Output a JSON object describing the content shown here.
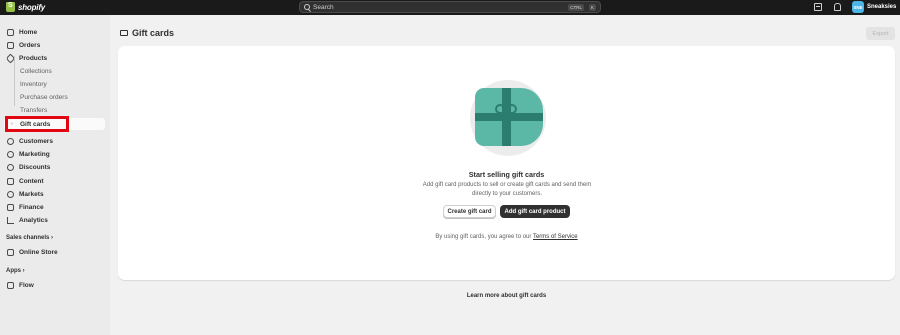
{
  "topbar": {
    "logo_text": "shopify",
    "search_placeholder": "Search",
    "shortcut_keys": [
      "CTRL",
      "K"
    ],
    "avatar_initials": "SNE",
    "store_name": "Sneaksies"
  },
  "sidebar": {
    "items": [
      {
        "label": "Home",
        "icon": "home-icon"
      },
      {
        "label": "Orders",
        "icon": "orders-icon"
      },
      {
        "label": "Products",
        "icon": "tag-icon"
      }
    ],
    "product_subitems": [
      "Collections",
      "Inventory",
      "Purchase orders",
      "Transfers"
    ],
    "active_item": "Gift cards",
    "items_after": [
      {
        "label": "Customers",
        "icon": "person-icon"
      },
      {
        "label": "Marketing",
        "icon": "target-icon"
      },
      {
        "label": "Discounts",
        "icon": "discount-icon"
      },
      {
        "label": "Content",
        "icon": "content-icon"
      },
      {
        "label": "Markets",
        "icon": "globe-icon"
      },
      {
        "label": "Finance",
        "icon": "bank-icon"
      },
      {
        "label": "Analytics",
        "icon": "chart-icon"
      }
    ],
    "sales_channels_label": "Sales channels",
    "online_store": "Online Store",
    "apps_label": "Apps",
    "flow": "Flow"
  },
  "main": {
    "title": "Gift cards",
    "export_label": "Export",
    "empty_heading": "Start selling gift cards",
    "empty_desc": "Add gift card products to sell or create gift cards and send them directly to your customers.",
    "create_button": "Create gift card",
    "add_button": "Add gift card product",
    "terms_prefix": "By using gift cards, you agree to our",
    "terms_link": "Terms of Service",
    "learn_more": "Learn more about gift cards"
  }
}
